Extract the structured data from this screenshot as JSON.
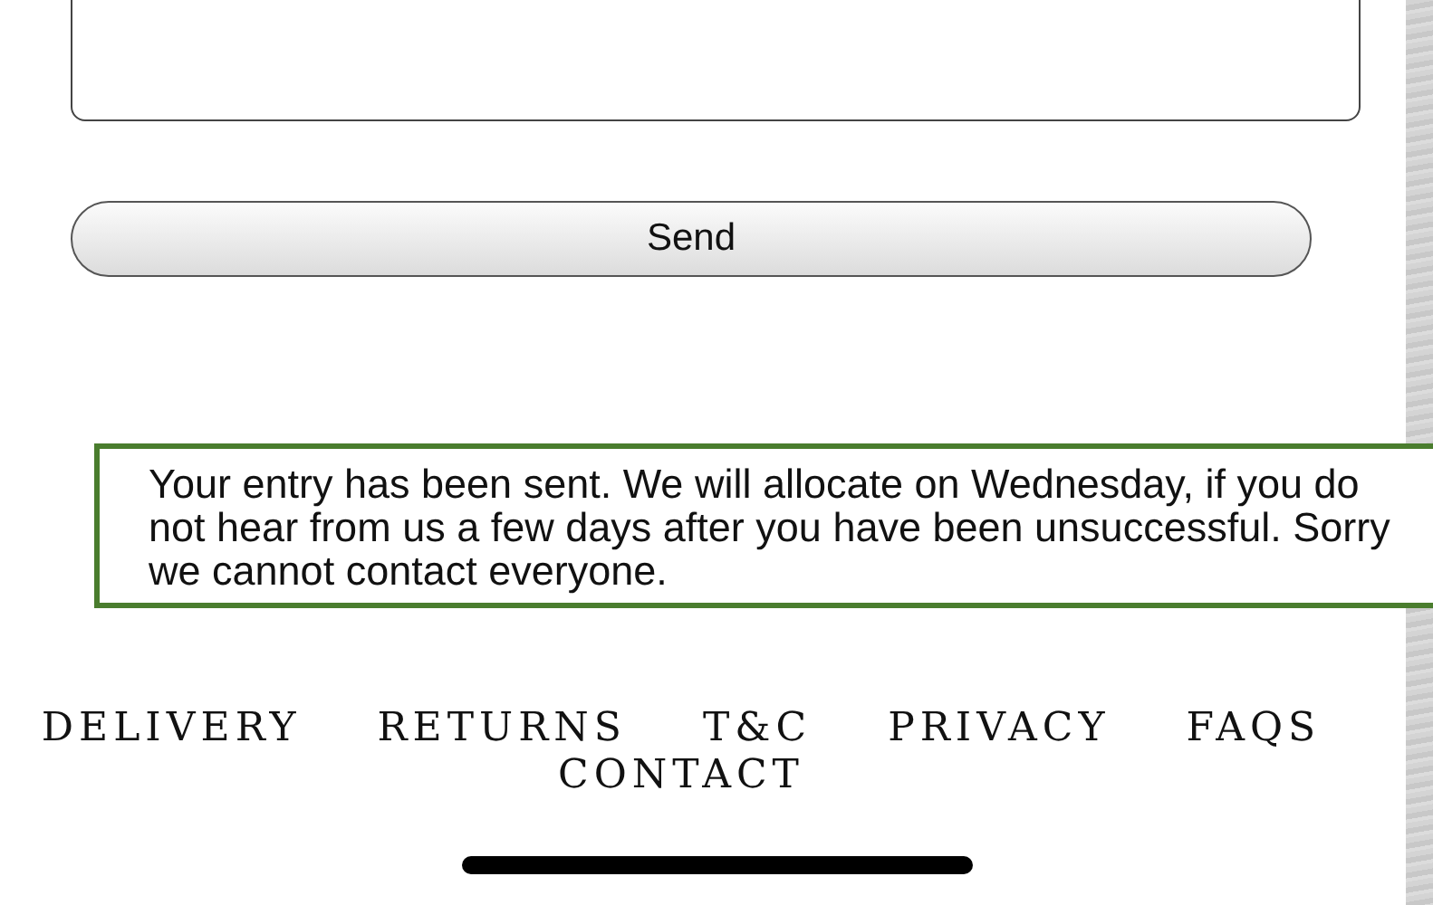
{
  "form": {
    "send_button": "Send"
  },
  "confirmation": {
    "message": "Your entry has been sent. We will allocate on Wednesday, if you do not hear from us a few days after you have been unsuccessful. Sorry we cannot contact everyone."
  },
  "footer_links": [
    "DELIVERY",
    "RETURNS",
    "T&C",
    "PRIVACY",
    "FAQS",
    "CONTACT"
  ]
}
